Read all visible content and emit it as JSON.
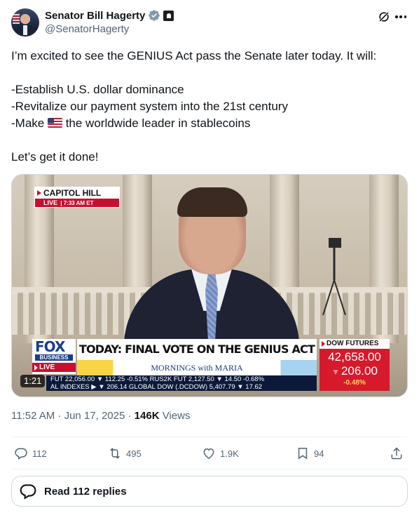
{
  "author": {
    "display_name": "Senator Bill Hagerty",
    "handle": "@SenatorHagerty"
  },
  "tweet": {
    "line1": "I’m excited to see the GENIUS Act pass the Senate later today. It will:",
    "bullet1": "-Establish U.S. dollar dominance",
    "bullet2": "-Revitalize our payment system into the 21st century",
    "bullet3_prefix": "-Make",
    "bullet3_suffix": "the worldwide leader in stablecoins",
    "closing": "Let’s get it done!"
  },
  "video": {
    "location_caption": "CAPITOL HILL",
    "live_label": "LIVE",
    "time_caption": "7:33 AM ET",
    "network_name": "FOX",
    "network_sub": "BUSINESS",
    "network_live": "LIVE",
    "headline": "TODAY: FINAL VOTE ON THE GENIUS ACT",
    "show_name": "MORNINGS with MARIA",
    "dow_label": "DOW FUTURES",
    "dow_value": "42,658.00",
    "dow_change": "206.00",
    "dow_pct": "-0.48%",
    "ticker_row1": "FUT  22,056.00 ▼ 112.25  -0.51%  RUS2K FUT  2,127.50 ▼ 14.50  -0.68%",
    "ticker_row2": "AL INDEXES ▶  ▼ 206.14  GLOBAL DOW (.DCDOW) 5,407.79 ▼ 17.62",
    "duration": "1:21"
  },
  "meta": {
    "timestamp": "11:52 AM · Jun 17, 2025 · ",
    "views_count": "146K",
    "views_label": " Views"
  },
  "actions": {
    "replies": "112",
    "reposts": "495",
    "likes": "1.9K",
    "bookmarks": "94"
  },
  "read_replies_label": "Read 112 replies",
  "colors": {
    "verified_blue": "#829aab",
    "text_primary": "#0f1419",
    "text_secondary": "#536471",
    "fox_red": "#c8102e",
    "fox_blue": "#1a3d8f"
  }
}
